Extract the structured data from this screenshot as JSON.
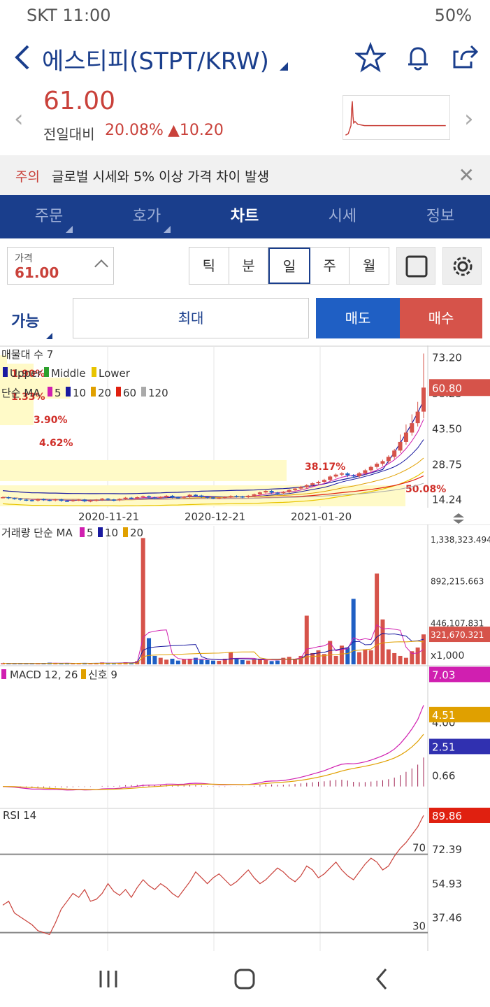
{
  "status": {
    "left": "SKT 11:00",
    "right": "50%"
  },
  "header": {
    "title": "에스티피(STPT/KRW)",
    "icons": [
      "star-icon",
      "bell-icon",
      "share-icon"
    ]
  },
  "price": {
    "current": "61.00",
    "compare_label": "전일대비",
    "change_pct": "20.08%",
    "change_abs": "▲10.20"
  },
  "notice": {
    "label": "주의",
    "message": "글로벌 시세와 5% 이상 가격 차이 발생"
  },
  "tabs": [
    {
      "label": "주문",
      "has_menu": true
    },
    {
      "label": "호가",
      "has_menu": true
    },
    {
      "label": "차트",
      "active": true
    },
    {
      "label": "시세"
    },
    {
      "label": "정보"
    }
  ],
  "controls": {
    "price_label": "가격",
    "price_value": "61.00",
    "periods": [
      "틱",
      "분",
      "일",
      "주",
      "월"
    ],
    "selected_period": "일"
  },
  "order": {
    "available_label": "가능",
    "max_label": "최대",
    "sell_label": "매도",
    "buy_label": "매수"
  },
  "colors": {
    "brand_blue": "#1a3e8c",
    "up_red": "#c9413a",
    "down_blue": "#1f5fc4",
    "ma5": "#d01fb0",
    "ma10": "#1a1aa0",
    "ma20": "#e0a000",
    "ma60": "#e02010",
    "ma120": "#aaaaaa"
  },
  "chart_data": {
    "type": "line",
    "price_panel": {
      "legend_line1": "매물대 수 7",
      "legend_line2": [
        "Upper",
        "Middle",
        "Lower"
      ],
      "legend_line3_title": "단순 MA",
      "legend_line3_items": [
        "5",
        "10",
        "20",
        "60",
        "120"
      ],
      "profile_labels": [
        "1.90%",
        "1.33%",
        "3.90%",
        "4.62%",
        "38.17%",
        "50.08%"
      ],
      "y_ticks": [
        "73.20",
        "58.25",
        "43.50",
        "28.75",
        "14.24"
      ],
      "current_tag": "60.80",
      "x_labels": [
        "2020-11-21",
        "2020-12-21",
        "2021-01-20"
      ],
      "close": [
        15.2,
        14.8,
        14.6,
        14.2,
        14.0,
        13.8,
        14.4,
        14.1,
        13.9,
        14.3,
        13.7,
        13.6,
        14.0,
        14.2,
        13.5,
        13.8,
        14.1,
        14.6,
        14.2,
        13.9,
        14.5,
        15.0,
        14.8,
        15.2,
        15.6,
        15.1,
        14.9,
        15.3,
        15.8,
        15.2,
        15.0,
        15.4,
        16.2,
        15.9,
        15.4,
        15.1,
        14.8,
        15.0,
        15.3,
        15.7,
        15.5,
        15.2,
        15.8,
        16.4,
        17.2,
        17.8,
        17.1,
        16.9,
        17.4,
        18.2,
        18.8,
        19.5,
        20.2,
        21.0,
        21.6,
        22.4,
        23.8,
        24.6,
        25.1,
        24.3,
        23.9,
        25.2,
        26.4,
        27.8,
        29.1,
        30.2,
        32.0,
        34.6,
        38.2,
        42.1,
        46.0,
        50.8,
        60.8
      ]
    },
    "volume_panel": {
      "legend": "거래량 단순 MA",
      "legend_items": [
        "5",
        "10",
        "20"
      ],
      "y_ticks": [
        "1,338,323.494",
        "892,215.663",
        "446,107.831"
      ],
      "current_tag": "321,670.321",
      "unit": "x1,000",
      "values": [
        12,
        8,
        10,
        9,
        7,
        11,
        9,
        14,
        18,
        10,
        9,
        12,
        8,
        15,
        10,
        9,
        11,
        20,
        14,
        12,
        15,
        22,
        18,
        35,
        1350,
        280,
        90,
        70,
        50,
        60,
        40,
        55,
        60,
        70,
        50,
        45,
        40,
        38,
        60,
        130,
        55,
        45,
        40,
        50,
        60,
        45,
        35,
        40,
        70,
        80,
        60,
        90,
        520,
        120,
        150,
        110,
        250,
        90,
        200,
        180,
        700,
        130,
        160,
        150,
        970,
        480,
        160,
        120,
        90,
        70,
        140,
        180,
        320
      ]
    },
    "macd_panel": {
      "legend": "MACD 12, 26",
      "signal_label": "신호 9",
      "y_ticks": [
        "4.00",
        "2.70",
        "0.66"
      ],
      "tags": [
        "7.03",
        "4.51",
        "2.51"
      ]
    },
    "rsi_panel": {
      "legend": "RSI 14",
      "y_ticks": [
        "72.39",
        "54.93",
        "37.46"
      ],
      "current_tag": "89.86",
      "levels": [
        "70",
        "30"
      ],
      "values": [
        44,
        46,
        40,
        38,
        36,
        34,
        31,
        30,
        29,
        35,
        42,
        46,
        50,
        48,
        52,
        46,
        47,
        50,
        55,
        51,
        49,
        52,
        48,
        53,
        57,
        54,
        52,
        55,
        53,
        50,
        48,
        52,
        56,
        61,
        58,
        55,
        58,
        60,
        57,
        54,
        56,
        59,
        62,
        58,
        55,
        57,
        60,
        63,
        61,
        58,
        56,
        59,
        64,
        62,
        58,
        60,
        63,
        66,
        62,
        59,
        57,
        61,
        65,
        68,
        66,
        62,
        64,
        69,
        73,
        76,
        80,
        84,
        89.86
      ]
    }
  }
}
